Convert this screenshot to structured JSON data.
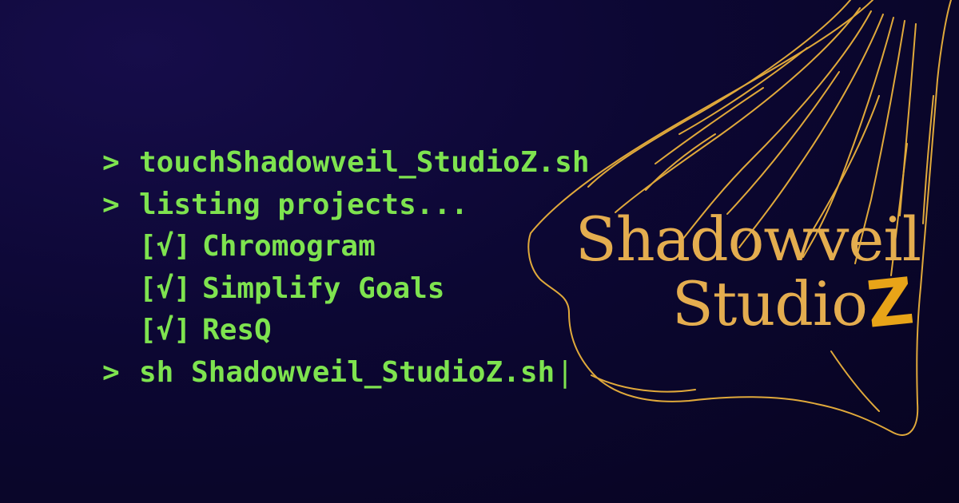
{
  "terminal": {
    "prompt_symbol": ">",
    "lines": [
      {
        "type": "command",
        "text": "touchShadowveil_StudioZ.sh"
      },
      {
        "type": "command",
        "text": "listing projects..."
      },
      {
        "type": "item",
        "check": "[√]",
        "text": "Chromogram"
      },
      {
        "type": "item",
        "check": "[√]",
        "text": "Simplify Goals"
      },
      {
        "type": "item",
        "check": "[√]",
        "text": "ResQ"
      },
      {
        "type": "command",
        "text": "sh Shadowveil_StudioZ.sh",
        "cursor": "|"
      }
    ]
  },
  "logo": {
    "line1": "Shadowveil",
    "line2_main": "Studio",
    "line2_accent": "Z"
  },
  "colors": {
    "background": "#0c0733",
    "terminal_text": "#7ee34f",
    "logo_text": "#e4ad4f",
    "logo_accent": "#e8a418",
    "veil_stroke": "#e0a93b"
  },
  "icons": {
    "veil": "veil-cloth-illustration"
  }
}
